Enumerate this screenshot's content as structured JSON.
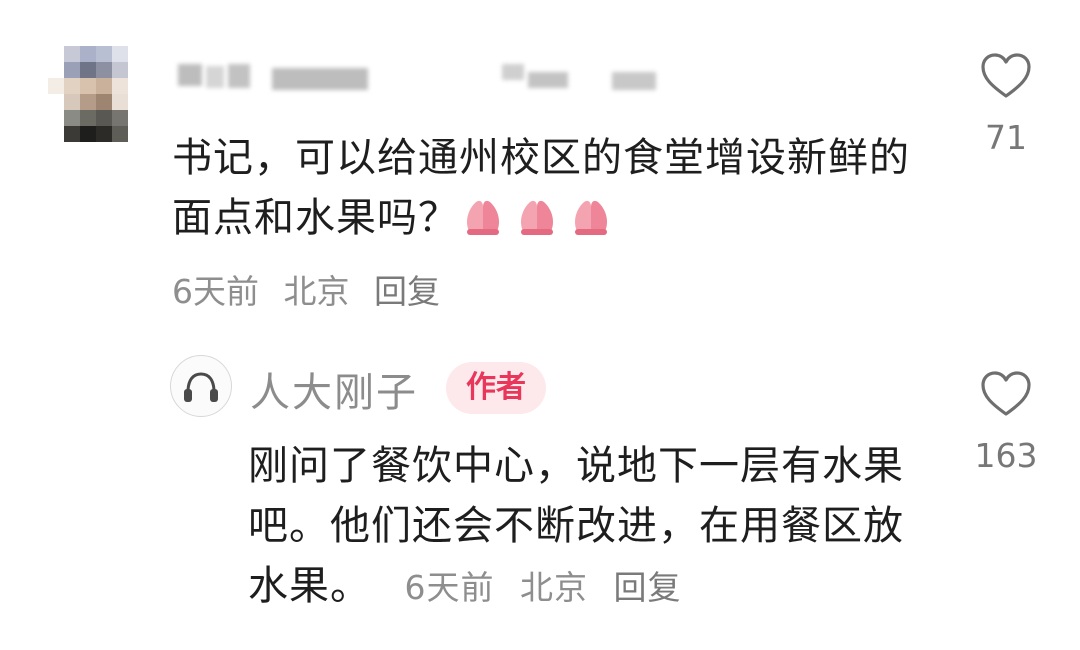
{
  "comment": {
    "text": "书记，可以给通州校区的食堂增设新鲜的面点和水果吗？",
    "emoji": "🙏🙏🙏",
    "time": "6天前",
    "location": "北京",
    "reply_label": "回复",
    "like_count": "71",
    "like_icon": "heart-outline-icon"
  },
  "reply": {
    "author": "人大刚子",
    "badge": "作者",
    "text": "刚问了餐饮中心，说地下一层有水果吧。他们还会不断改进，在用餐区放水果。",
    "time": "6天前",
    "location": "北京",
    "reply_label": "回复",
    "like_count": "163",
    "like_icon": "heart-outline-icon",
    "avatar_icon": "headphones-icon"
  },
  "colors": {
    "badge_bg": "#fde9ec",
    "badge_text": "#e8375a",
    "meta_text": "#8e8e8e"
  }
}
